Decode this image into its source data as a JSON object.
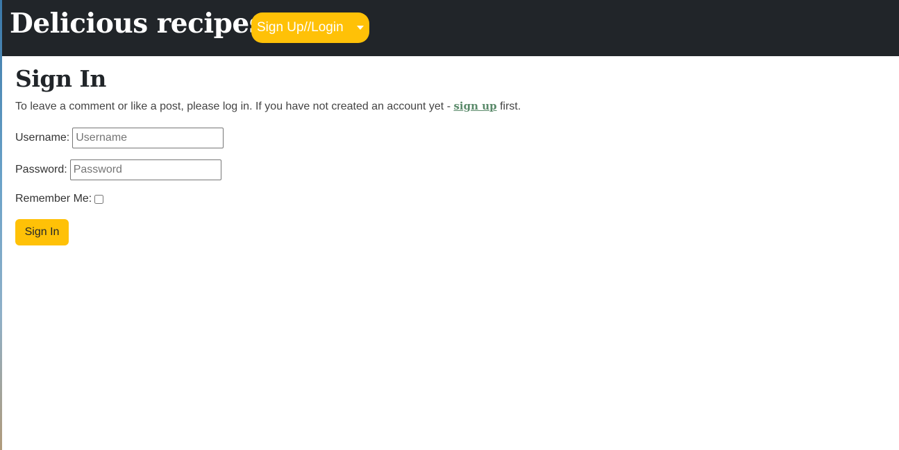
{
  "header": {
    "brand": "Delicious recipes",
    "auth_menu_label": "Sign Up//Login"
  },
  "main": {
    "title": "Sign In",
    "intro_before": "To leave a comment or like a post, please log in. If you have not created an account yet - ",
    "intro_link": "sign up",
    "intro_after": " first."
  },
  "form": {
    "username_label": "Username:",
    "username_placeholder": "Username",
    "username_value": "",
    "password_label": "Password:",
    "password_placeholder": "Password",
    "password_value": "",
    "remember_label": "Remember Me:",
    "remember_checked": false,
    "submit_label": "Sign In"
  },
  "colors": {
    "navbar": "#212529",
    "accent": "#ffc107",
    "link": "#5a8a6a"
  }
}
